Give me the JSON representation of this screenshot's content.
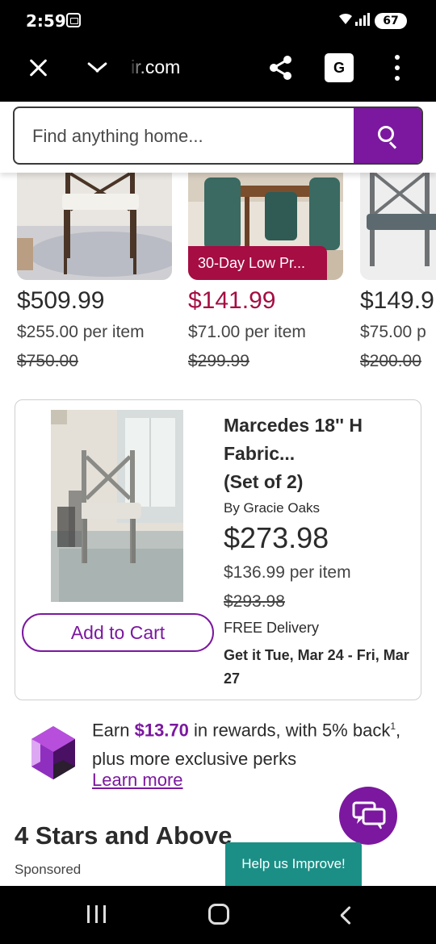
{
  "status_bar": {
    "time": "2:59",
    "battery": "67"
  },
  "browser": {
    "url": "ir.com",
    "translate_label": "G"
  },
  "search": {
    "placeholder": "Find anything home..."
  },
  "carousel": {
    "items": [
      {
        "price": "$509.99",
        "per_item": "$255.00 per item",
        "original": "$750.00",
        "badge": ""
      },
      {
        "price": "$141.99",
        "per_item": "$71.00 per item",
        "original": "$299.99",
        "badge": "30-Day Low Pr..."
      },
      {
        "price": "$149.9",
        "per_item": "$75.00 p",
        "original": "$200.00",
        "badge": ""
      }
    ]
  },
  "product": {
    "title_line1": "Marcedes 18'' H",
    "title_line2": "Fabric...",
    "title_line3": "(Set of 2)",
    "brand": "By Gracie Oaks",
    "price": "$273.98",
    "per_item": "$136.99 per item",
    "original": "$293.98",
    "delivery": "FREE Delivery",
    "delivery_date": "Get it Tue, Mar 24 - Fri, Mar 27",
    "add_to_cart": "Add to Cart"
  },
  "rewards": {
    "prefix": "Earn ",
    "amount": "$13.70",
    "middle": " in rewards, with 5% back",
    "superscript": "1",
    "suffix": ", plus more exclusive perks",
    "learn_more": "Learn more"
  },
  "section": {
    "title": "4 Stars and Above",
    "sponsored": "Sponsored"
  },
  "help": {
    "label": "Help us Improve!"
  },
  "colors": {
    "brand_purple": "#7b189f",
    "sale_red": "#a50d43",
    "help_teal": "#1b8f86"
  }
}
